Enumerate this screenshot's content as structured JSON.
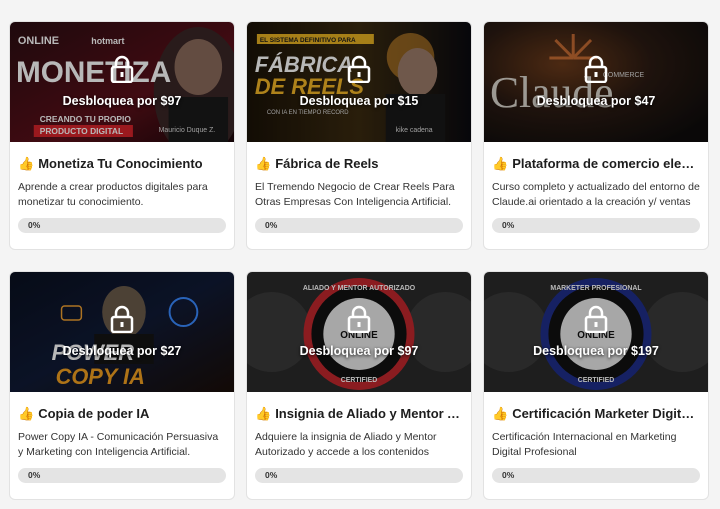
{
  "colors": {
    "card_bg": "#ffffff",
    "page_bg": "#f4f4f4",
    "progress_track": "#e4e4e4",
    "title_text": "#1d1d1d"
  },
  "icons": {
    "lock": "lock-icon",
    "pointing_hand": "pointing-hand-icon"
  },
  "courses": [
    {
      "unlock_label": "Desbloquea por $97",
      "title": "Monetiza Tu Conocimiento",
      "description": "Aprende a crear productos digitales para monetizar tu conocimiento.",
      "progress_label": "0%",
      "progress": 0,
      "thumb_texts": {
        "line1": "MONETIZA",
        "line2": "CREANDO TU PROPIO",
        "line3": "PRODUCTO DIGITAL",
        "brand": "ONLINE",
        "brand2": "hotmart",
        "author": "Mauricio Duque Z."
      }
    },
    {
      "unlock_label": "Desbloquea por $15",
      "title": "Fábrica de Reels",
      "description": "El Tremendo Negocio de Crear Reels Para Otras Empresas Con Inteligencia Artificial.",
      "progress_label": "0%",
      "progress": 0,
      "thumb_texts": {
        "top": "EL SISTEMA DEFINITIVO PARA",
        "line1": "FÁBRICA",
        "line2": "DE REELS",
        "sub": "CON IA EN TIEMPO RECORD",
        "author": "kike cadena"
      }
    },
    {
      "unlock_label": "Desbloquea por $47",
      "title": "Plataforma de comercio electrónico",
      "description": "Curso completo y actualizado del entorno de Claude.ai orientado a la creación y/ ventas de productos.",
      "progress_label": "0%",
      "progress": 0,
      "thumb_texts": {
        "line1": "Claude",
        "small": "COMMERCE"
      }
    },
    {
      "unlock_label": "Desbloquea por $27",
      "title": "Copia de poder IA",
      "description": "Power Copy IA - Comunicación Persuasiva y Marketing con Inteligencia Artificial.",
      "progress_label": "0%",
      "progress": 0,
      "thumb_texts": {
        "line1": "POWER",
        "line2": "COPY IA"
      }
    },
    {
      "unlock_label": "Desbloquea por $97",
      "title": "Insignia de Aliado y Mentor Autorizado",
      "description": "Adquiere la insignia de Aliado y Mentor Autorizado y accede a los contenidos exclusivos.",
      "progress_label": "0%",
      "progress": 0,
      "thumb_texts": {
        "ring": "ALIADO Y MENTOR AUTORIZADO",
        "brand": "ONLINE",
        "bottom": "CERTIFIED"
      }
    },
    {
      "unlock_label": "Desbloquea por $197",
      "title": "Certificación Marketer Digital Profesional",
      "description": "Certificación Internacional en Marketing Digital Profesional",
      "progress_label": "0%",
      "progress": 0,
      "thumb_texts": {
        "ring": "MARKETER PROFESIONAL",
        "brand": "ONLINE",
        "bottom": "CERTIFIED"
      }
    }
  ]
}
